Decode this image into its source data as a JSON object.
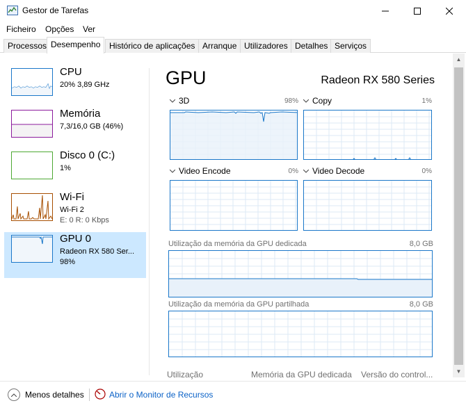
{
  "window": {
    "title": "Gestor de Tarefas"
  },
  "menu": [
    "Ficheiro",
    "Opções",
    "Ver"
  ],
  "tabs": [
    "Processos",
    "Desempenho",
    "Histórico de aplicações",
    "Arranque",
    "Utilizadores",
    "Detalhes",
    "Serviços"
  ],
  "resources": [
    {
      "name": "CPU",
      "detail": "20% 3,89 GHz",
      "detail2": "",
      "color": "#1a77c9"
    },
    {
      "name": "Memória",
      "detail": "7,3/16,0 GB (46%)",
      "detail2": "",
      "color": "#8b1a9c"
    },
    {
      "name": "Disco 0 (C:)",
      "detail": "1%",
      "detail2": "",
      "color": "#4da833"
    },
    {
      "name": "Wi-Fi",
      "detail": "Wi-Fi 2",
      "detail2": "E: 0 R: 0 Kbps",
      "color": "#a74f01"
    },
    {
      "name": "GPU 0",
      "detail": "Radeon RX 580 Ser...",
      "detail2": "98%",
      "color": "#1a77c9"
    }
  ],
  "gpu": {
    "title": "GPU",
    "model": "Radeon RX 580 Series",
    "engines": [
      {
        "label": "3D",
        "value": "98%"
      },
      {
        "label": "Copy",
        "value": "1%"
      },
      {
        "label": "Video Encode",
        "value": "0%"
      },
      {
        "label": "Video Decode",
        "value": "0%"
      }
    ],
    "dedicated_label": "Utilização da memória da GPU dedicada",
    "dedicated_value": "8,0 GB",
    "shared_label": "Utilização da memória da GPU partilhada",
    "shared_value": "8,0 GB",
    "bottom_labels": [
      "Utilização",
      "Memória da GPU dedicada",
      "Versão do control..."
    ]
  },
  "footer": {
    "less_details": "Menos detalhes",
    "monitor_link": "Abrir o Monitor de Recursos"
  },
  "colors": {
    "accent": "#1a77c9",
    "selection": "#cce8ff",
    "link": "#0b62c7"
  }
}
